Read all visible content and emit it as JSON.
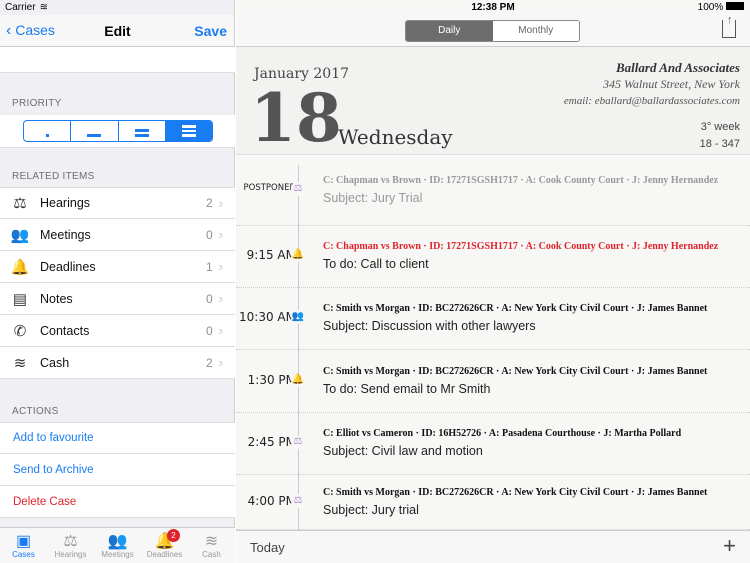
{
  "status": {
    "carrier": "Carrier",
    "time": "12:38 PM",
    "battery": "100%"
  },
  "left_nav": {
    "back": "Cases",
    "title": "Edit",
    "save": "Save"
  },
  "priority": {
    "header": "PRIORITY",
    "levels": [
      "low",
      "medium",
      "high",
      "urgent"
    ],
    "selected": 3
  },
  "related": {
    "header": "RELATED ITEMS",
    "items": [
      {
        "label": "Hearings",
        "count": "2",
        "icon": "⚖"
      },
      {
        "label": "Meetings",
        "count": "0",
        "icon": "👥"
      },
      {
        "label": "Deadlines",
        "count": "1",
        "icon": "🔔"
      },
      {
        "label": "Notes",
        "count": "0",
        "icon": "▤"
      },
      {
        "label": "Contacts",
        "count": "0",
        "icon": "✆"
      },
      {
        "label": "Cash",
        "count": "2",
        "icon": "≋"
      }
    ]
  },
  "actions": {
    "header": "ACTIONS",
    "add_favourite": "Add to favourite",
    "archive": "Send to Archive",
    "delete": "Delete Case"
  },
  "tabs": [
    {
      "label": "Cases",
      "icon": "▣"
    },
    {
      "label": "Hearings",
      "icon": "⚖"
    },
    {
      "label": "Meetings",
      "icon": "👥"
    },
    {
      "label": "Deadlines",
      "icon": "🔔",
      "badge": "2"
    },
    {
      "label": "Cash",
      "icon": "≋"
    }
  ],
  "view_toggle": {
    "daily": "Daily",
    "monthly": "Monthly",
    "selected": "Daily"
  },
  "date": {
    "month_year": "January 2017",
    "day": "18",
    "weekday": "Wednesday",
    "week": "3° week",
    "day_of_year": "18 - 347"
  },
  "firm": {
    "name": "Ballard And Associates",
    "address": "345 Walnut Street, New York",
    "email": "email: eballard@ballardassociates.com"
  },
  "colors": {
    "accent": "#1a7cf2",
    "red": "#e0232b",
    "orange": "#f5a04a",
    "purple": "#b48fd0",
    "blue": "#3a9fe0"
  },
  "entries": [
    {
      "time": "POSTPONED",
      "icon": "⚖",
      "color": "#b48fd0",
      "meta": "C: Chapman vs Brown  ·  ID: 17271SGSH1717  ·  A: Cook County Court  ·  J: Jenny Hernandez",
      "subject": "Subject: Jury Trial",
      "style": "muted"
    },
    {
      "time": "9:15 AM",
      "icon": "🔔",
      "color": "#f5a04a",
      "meta": "C: Chapman vs Brown  ·  ID: 17271SGSH1717  ·  A: Cook County Court  ·  J: Jenny Hernandez",
      "subject": "To do: Call to client",
      "style": "red"
    },
    {
      "time": "10:30 AM",
      "icon": "👥",
      "color": "#3a9fe0",
      "meta": "C: Smith vs Morgan  ·  ID: BC272626CR  ·  A: New York City Civil Court  ·  J: James Bannet",
      "subject": "Subject: Discussion with other lawyers",
      "style": "normal"
    },
    {
      "time": "1:30 PM",
      "icon": "🔔",
      "color": "#f5a04a",
      "meta": "C: Smith vs Morgan  ·  ID: BC272626CR  ·  A: New York City Civil Court  ·  J: James Bannet",
      "subject": "To do: Send email to Mr Smith",
      "style": "normal"
    },
    {
      "time": "2:45 PM",
      "icon": "⚖",
      "color": "#b48fd0",
      "meta": "C: Elliot vs Cameron  ·  ID: 16H52726  ·  A: Pasadena Courthouse  ·  J: Martha Pollard",
      "subject": "Subject: Civil law and motion",
      "style": "normal"
    },
    {
      "time": "4:00 PM",
      "icon": "⚖",
      "color": "#b48fd0",
      "meta": "C: Smith vs Morgan  ·  ID: BC272626CR  ·  A: New York City Civil Court  ·  J: James Bannet",
      "subject": "Subject: Jury trial",
      "style": "normal"
    }
  ],
  "bottom": {
    "today": "Today",
    "add": "+"
  }
}
